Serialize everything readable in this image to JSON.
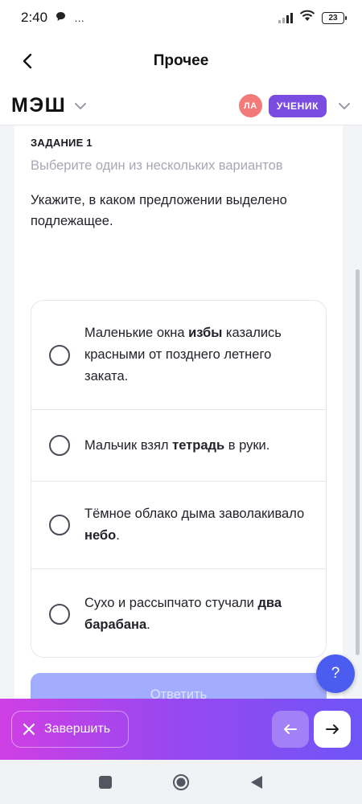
{
  "status_bar": {
    "time": "2:40",
    "notification_icon": "chat-bubble-icon",
    "more_icon": "…",
    "battery_level": "23"
  },
  "nav": {
    "title": "Прочее",
    "back_icon": "chevron-left-icon"
  },
  "header": {
    "logo": "МЭШ",
    "avatar_initials": "ЛА",
    "role": "УЧЕНИК",
    "colors": {
      "avatar": "#f47a7a",
      "role_badge": "#7a4ce0"
    }
  },
  "task": {
    "label": "ЗАДАНИЕ 1",
    "hint": "Выберите один из нескольких вариантов",
    "question": "Укажите, в каком предложении выделено подлежащее."
  },
  "options": [
    {
      "before": "Маленькие окна ",
      "bold": "избы",
      "after": " казались красными от позднего летнего заката."
    },
    {
      "before": "Мальчик взял ",
      "bold": "тетрадь",
      "after": " в руки."
    },
    {
      "before": "Тёмное облако дыма заволакивало ",
      "bold": "небо",
      "after": "."
    },
    {
      "before": "Сухо и рассыпчато стучали ",
      "bold": "два барабана",
      "after": "."
    }
  ],
  "answer_button": {
    "label": "Ответить",
    "color": "#a3adff"
  },
  "help_button": {
    "label": "?",
    "color": "#4b5cf0"
  },
  "bottom_bar": {
    "finish_label": "Завершить",
    "gradient": [
      "#cf3fe4",
      "#6f55f7"
    ]
  }
}
